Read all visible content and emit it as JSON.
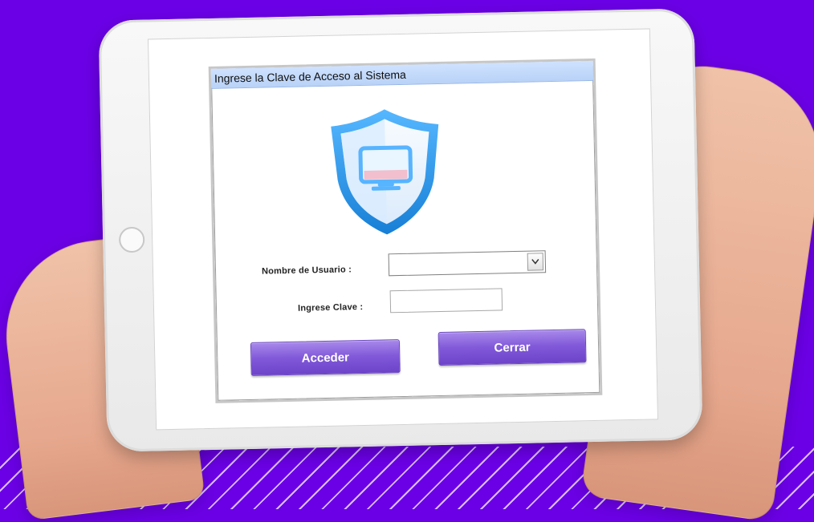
{
  "window": {
    "title": "Ingrese la Clave de Acceso al Sistema"
  },
  "form": {
    "username_label": "Nombre de Usuario :",
    "password_label": "Ingrese Clave :",
    "username_value": "",
    "password_value": ""
  },
  "buttons": {
    "access_label": "Acceder",
    "close_label": "Cerrar"
  },
  "icons": {
    "shield": "shield-icon",
    "monitor": "monitor-icon",
    "dropdown": "chevron-down-icon"
  },
  "colors": {
    "background": "#6b00e6",
    "titlebar": "#b8d2f7",
    "button": "#8159d9"
  }
}
